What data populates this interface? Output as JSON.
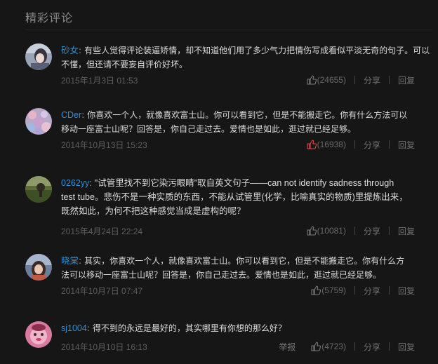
{
  "section_title": "精彩评论",
  "labels": {
    "share": "分享",
    "reply": "回复",
    "report": "举报"
  },
  "colors": {
    "background": "#161616",
    "username": "#2e8fd6",
    "text": "#dcdcdc",
    "timestamp": "#5e5e5e",
    "like_active": "#e14a4a"
  },
  "comments": [
    {
      "user": "砂女",
      "text": "有些人觉得评论装逼矫情，却不知道他们用了多少气力把情伤写成看似平淡无奇的句子。可以不懂，但还请不要妄自评价好坏。",
      "time": "2015年1月3日 01:53",
      "likes": "(24655)",
      "liked": false,
      "avatar_icon": "portrait-avatar-icon"
    },
    {
      "user": "CDer",
      "text": "你喜欢一个人，就像喜欢富士山。你可以看到它，但是不能搬走它。你有什么方法可以移动一座富士山呢？回答是，你自己走过去。爱情也是如此，逛过就已经足够。",
      "time": "2014年10月13日 15:23",
      "likes": "(16938)",
      "liked": true,
      "avatar_icon": "floral-avatar-icon"
    },
    {
      "user": "0262yy",
      "text": "\"试管里找不到它染污眼睛\"取自英文句子——can not identify sadness through test tube。悲伤不是一种实质的东西，不能从试管里(化学，比喻真实的物质)里提炼出来，既然如此，为何不把这种感觉当成是虚构的呢？",
      "time": "2015年4月24日 22:24",
      "likes": "(10081)",
      "liked": false,
      "avatar_icon": "landscape-avatar-icon"
    },
    {
      "user": "晓棠",
      "text": "其实，你喜欢一个人，就像喜欢富士山。你可以看到它，但是不能搬走它。你有什么方法可以移动一座富士山呢？回答是，你自己走过去。爱情也是如此，逛过就已经足够。",
      "time": "2014年10月7日 07:47",
      "likes": "(5759)",
      "liked": false,
      "avatar_icon": "character-avatar-icon"
    },
    {
      "user": "sj1004",
      "text": "得不到的永远是最好的，其实哪里有你想的那么好？",
      "time": "2014年10月10日 16:13",
      "likes": "(4723)",
      "liked": false,
      "show_report": true,
      "avatar_icon": "cartoon-avatar-icon"
    }
  ]
}
